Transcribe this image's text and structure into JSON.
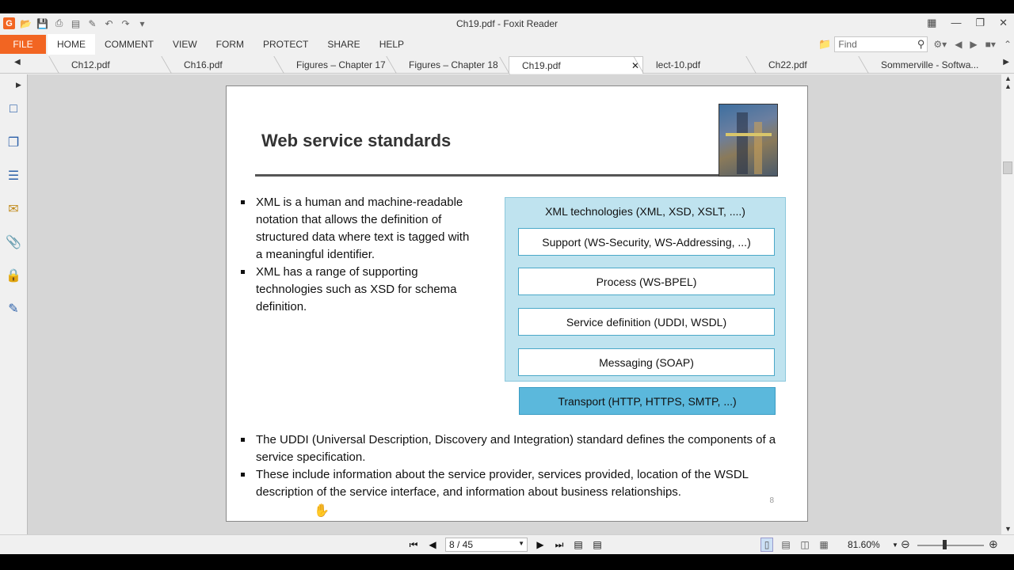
{
  "window": {
    "title": "Ch19.pdf - Foxit Reader",
    "app_logo": "G",
    "quick_access_icons": [
      "folder-open-icon",
      "save-icon",
      "print-icon",
      "scan-icon",
      "stamp-icon",
      "undo-icon",
      "redo-icon",
      "customize-icon"
    ]
  },
  "menu": {
    "file_label": "FILE",
    "items": [
      "HOME",
      "COMMENT",
      "VIEW",
      "FORM",
      "PROTECT",
      "SHARE",
      "HELP"
    ],
    "active": "HOME"
  },
  "search": {
    "placeholder": "Find"
  },
  "tabs": [
    {
      "label": "Ch12.pdf"
    },
    {
      "label": "Ch16.pdf"
    },
    {
      "label": "Figures – Chapter 17"
    },
    {
      "label": "Figures – Chapter 18"
    },
    {
      "label": "Ch19.pdf",
      "active": true
    },
    {
      "label": "lect-10.pdf"
    },
    {
      "label": "Ch22.pdf"
    },
    {
      "label": "Sommerville - Softwa..."
    }
  ],
  "slide": {
    "title": "Web service standards",
    "bullets_top": [
      "XML is a human and machine-readable notation that allows the definition of structured data where text is tagged with a meaningful identifier.",
      "XML has a range of supporting technologies such as XSD for schema definition."
    ],
    "diagram": {
      "outer_label": "XML technologies (XML, XSD, XSLT, ....)",
      "layers": [
        "Support (WS-Security, WS-Addressing, ...)",
        "Process (WS-BPEL)",
        "Service definition (UDDI, WSDL)",
        "Messaging (SOAP)"
      ],
      "transport": "Transport (HTTP, HTTPS, SMTP, ...)"
    },
    "bullets_bottom": [
      "The UDDI (Universal Description, Discovery and Integration) standard defines the components of a service specification.",
      "These include information about the service provider, services provided, location of the WSDL description of the service interface, and information about business relationships."
    ],
    "page_number": "8"
  },
  "status": {
    "page_display": "8 / 45",
    "zoom": "81.60%"
  },
  "colors": {
    "brand_orange": "#f26522",
    "diagram_light": "#bfe3ef",
    "diagram_transport": "#5bb8dc"
  }
}
